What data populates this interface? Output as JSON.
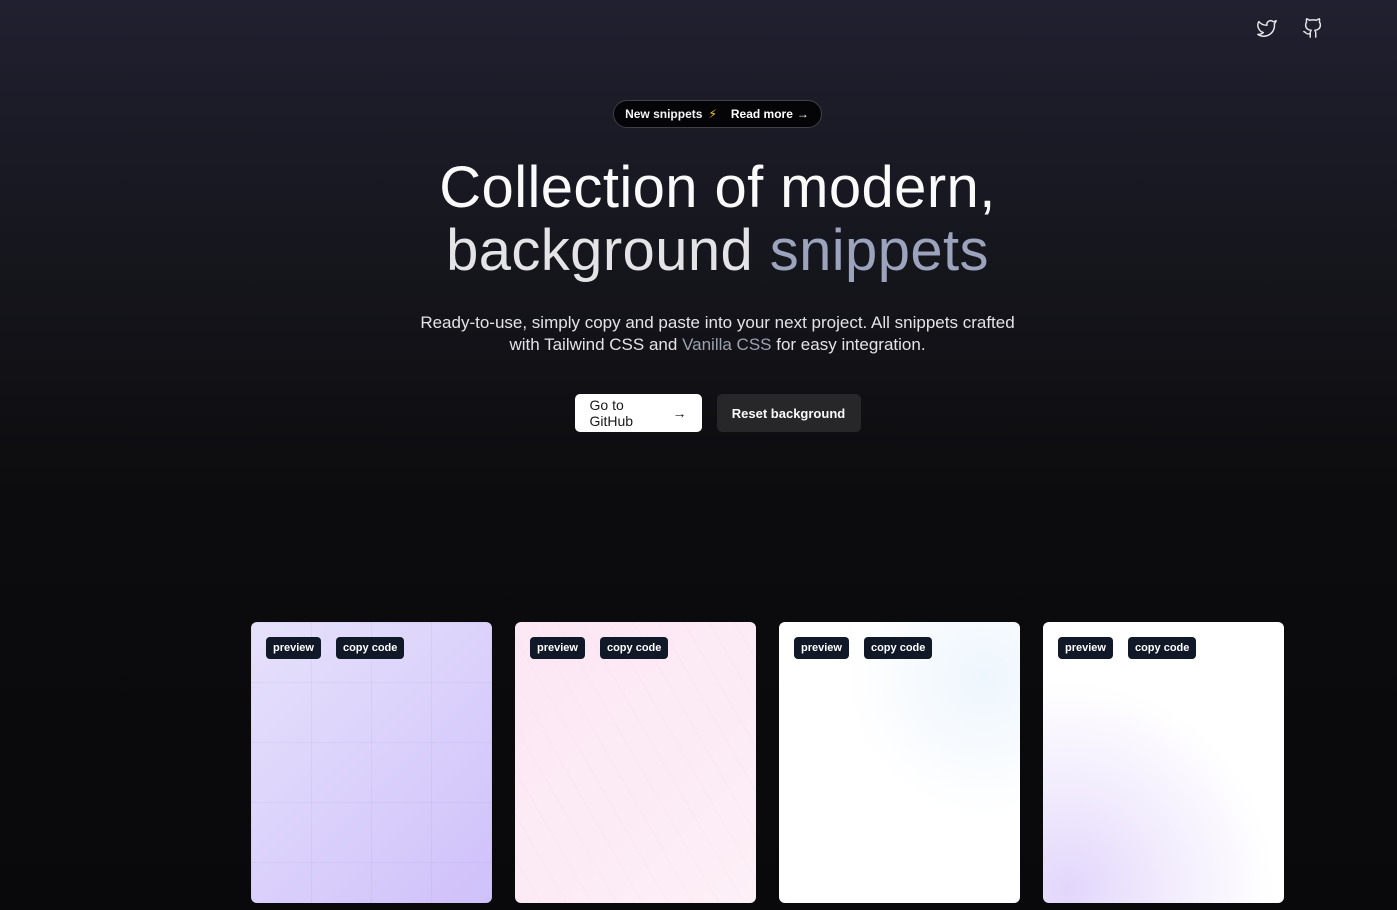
{
  "nav": {
    "icons": [
      "twitter-icon",
      "github-icon"
    ]
  },
  "announcement": {
    "text": "New snippets",
    "icon": "⚡",
    "link_label": "Read more",
    "link_arrow": "→"
  },
  "hero": {
    "title_line1": "Collection of modern,",
    "title_line2_a": "background",
    "title_line2_b": "snippets",
    "subtitle_part1": "Ready-to-use, simply copy and paste into your next project. All snippets crafted with Tailwind CSS and",
    "subtitle_link": "Vanilla CSS",
    "subtitle_part2": "for easy integration."
  },
  "actions": {
    "github_label": "Go to GitHub",
    "github_arrow": "→",
    "reset_label": "Reset background"
  },
  "cards": [
    {
      "preview_label": "preview",
      "copy_label": "copy code",
      "bg": "#dcd3fb"
    },
    {
      "preview_label": "preview",
      "copy_label": "copy code",
      "bg": "#fce7f5"
    },
    {
      "preview_label": "preview",
      "copy_label": "copy code",
      "bg": "#ffffff"
    },
    {
      "preview_label": "preview",
      "copy_label": "copy code",
      "bg": "#f1ebfd"
    }
  ],
  "colors": {
    "page_bg_top": "#202030",
    "page_bg_bottom": "#09090b",
    "accent_title": "#9ba3bd",
    "chip_bg": "#111827",
    "bolt": "#facc15"
  }
}
